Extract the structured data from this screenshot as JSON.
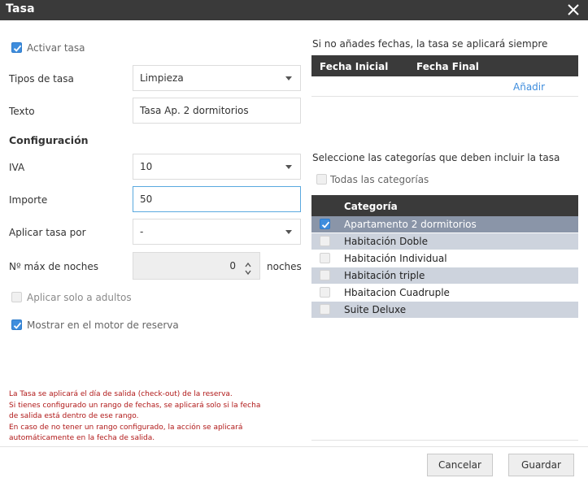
{
  "window": {
    "title": "Tasa"
  },
  "left": {
    "activar_label": "Activar tasa",
    "tipos_label": "Tipos de tasa",
    "tipos_value": "Limpieza",
    "texto_label": "Texto",
    "texto_value": "Tasa Ap. 2 dormitorios",
    "config_heading": "Configuración",
    "iva_label": "IVA",
    "iva_value": "10",
    "importe_label": "Importe",
    "importe_value": "50",
    "aplicar_label": "Aplicar tasa por",
    "aplicar_value": "-",
    "noches_label": "Nº máx de noches",
    "noches_value": "0",
    "noches_unit": "noches",
    "adultos_label": "Aplicar solo a adultos",
    "mostrar_label": "Mostrar en el motor de reserva"
  },
  "right": {
    "dates_hint": "Si no añades fechas, la tasa se aplicará siempre",
    "col_start": "Fecha Inicial",
    "col_end": "Fecha Final",
    "add_link": "Añadir",
    "cats_hint": "Seleccione las categorías que deben incluir la tasa",
    "all_cats_label": "Todas las categorías",
    "cat_col": "Categoría",
    "categories": [
      {
        "name": "Apartamento 2 dormitorios",
        "checked": true
      },
      {
        "name": "Habitación Doble",
        "checked": false
      },
      {
        "name": "Habitación Individual",
        "checked": false
      },
      {
        "name": "Habitación triple",
        "checked": false
      },
      {
        "name": "Hbaitacion Cuadruple",
        "checked": false
      },
      {
        "name": "Suite Deluxe",
        "checked": false
      }
    ]
  },
  "note": [
    "La Tasa se aplicará el día de salida (check-out) de la reserva.",
    "Si tienes configurado un rango de fechas, se aplicará solo si la fecha",
    "de salida está dentro de ese rango.",
    "En caso de no tener un rango configurado, la acción se aplicará",
    "automáticamente en la fecha de salida."
  ],
  "footer": {
    "cancel_label": "Cancelar",
    "save_label": "Guardar"
  },
  "colors": {
    "accent": "#3e8ddd",
    "header_bg": "#3a3a3a",
    "note_red": "#b01818",
    "selected_row": "#8a95a8",
    "alt_row": "#cdd3dd"
  }
}
